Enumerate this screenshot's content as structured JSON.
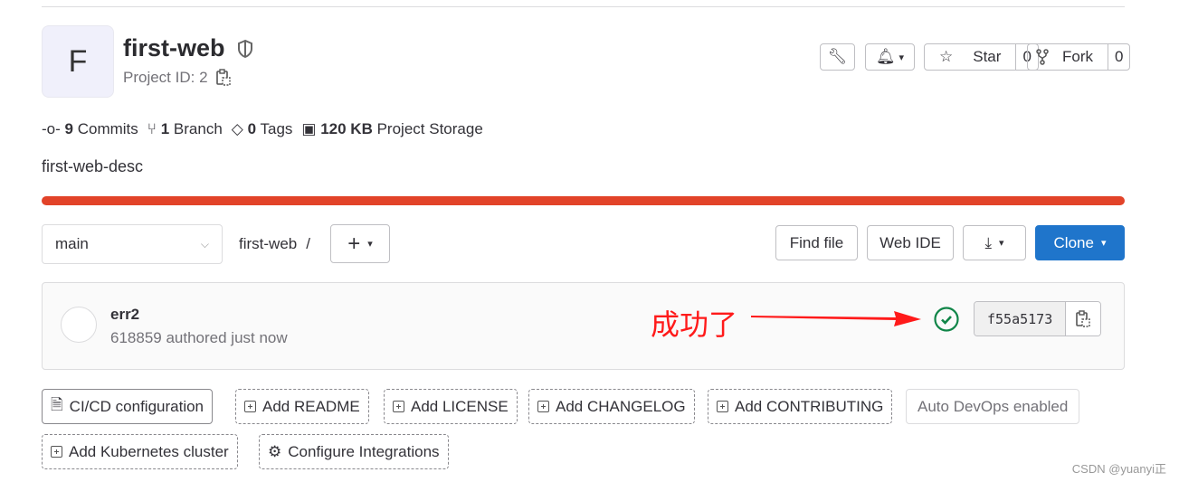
{
  "project": {
    "avatar_letter": "F",
    "name": "first-web",
    "id_label": "Project ID: 2",
    "description": "first-web-desc"
  },
  "header_actions": {
    "star_label": "Star",
    "star_count": "0",
    "fork_label": "Fork",
    "fork_count": "0"
  },
  "stats": [
    {
      "value": "9",
      "label": "Commits"
    },
    {
      "value": "1",
      "label": "Branch"
    },
    {
      "value": "0",
      "label": "Tags"
    },
    {
      "value": "120 KB",
      "label": "Project Storage"
    }
  ],
  "colors": {
    "progress_bar": "#e24329",
    "primary": "#1f75cb",
    "success": "#108548",
    "annotation": "#ff1a1a"
  },
  "toolbar": {
    "branch": "main",
    "path": "first-web",
    "separator": "/",
    "find_file": "Find file",
    "web_ide": "Web IDE",
    "clone": "Clone"
  },
  "commit": {
    "title": "err2",
    "meta": "618859 authored just now",
    "sha": "f55a5173",
    "annotation": "成功了",
    "status": "success"
  },
  "quick_actions": [
    "CI/CD configuration",
    "Add README",
    "Add LICENSE",
    "Add CHANGELOG",
    "Add CONTRIBUTING",
    "Auto DevOps enabled",
    "Add Kubernetes cluster",
    "Configure Integrations"
  ],
  "watermark": "CSDN @yuanyi正"
}
